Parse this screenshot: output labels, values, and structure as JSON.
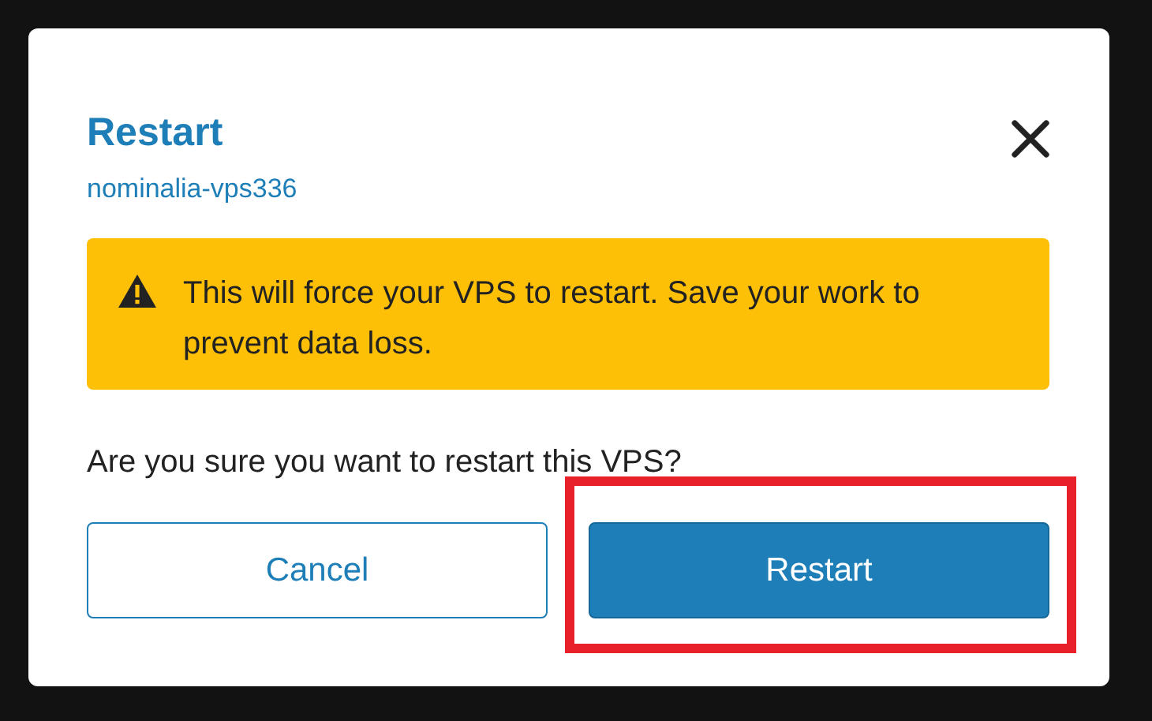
{
  "dialog": {
    "title": "Restart",
    "subtitle": "nominalia-vps336",
    "warning": "This will force your VPS to restart. Save your work to prevent data loss.",
    "question": "Are you sure you want to restart this VPS?",
    "buttons": [
      {
        "label": "Cancel",
        "kind": "secondary",
        "highlighted": false
      },
      {
        "label": "Restart",
        "kind": "primary",
        "highlighted": true
      }
    ]
  }
}
